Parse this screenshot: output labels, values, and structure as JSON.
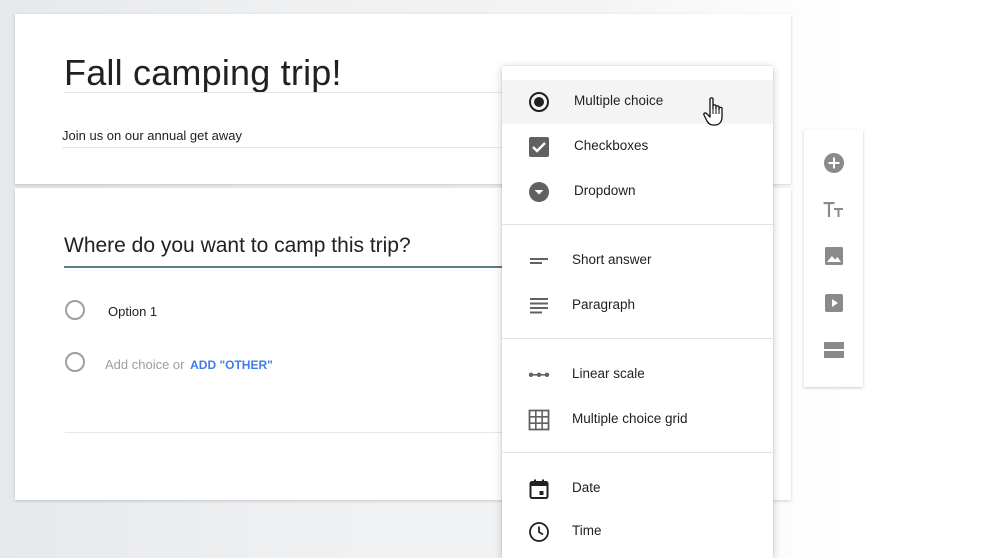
{
  "form": {
    "title": "Fall camping trip!",
    "description": "Join us on our annual get away"
  },
  "question": {
    "title": "Where do you want to camp this trip?",
    "option_1": "Option 1",
    "add_choice_text": "Add choice or",
    "add_other_label": "ADD \"OTHER\""
  },
  "type_menu": {
    "items": [
      {
        "label": "Multiple choice",
        "icon": "radio-checked-icon",
        "highlighted": true
      },
      {
        "label": "Checkboxes",
        "icon": "checkbox-icon"
      },
      {
        "label": "Dropdown",
        "icon": "dropdown-icon"
      },
      {
        "label": "Short answer",
        "icon": "short-answer-icon"
      },
      {
        "label": "Paragraph",
        "icon": "paragraph-icon"
      },
      {
        "label": "Linear scale",
        "icon": "linear-scale-icon"
      },
      {
        "label": "Multiple choice grid",
        "icon": "grid-icon"
      },
      {
        "label": "Date",
        "icon": "calendar-icon"
      },
      {
        "label": "Time",
        "icon": "clock-icon"
      }
    ]
  },
  "side_toolbar": {
    "tools": [
      "add-question-icon",
      "title-text-icon",
      "image-icon",
      "video-icon",
      "section-icon"
    ]
  },
  "colors": {
    "accent_link": "#3f7ee6",
    "icon_gray": "#616161",
    "toolbar_icon_gray": "#8a8a8a",
    "question_underline": "#5f7a8c"
  }
}
